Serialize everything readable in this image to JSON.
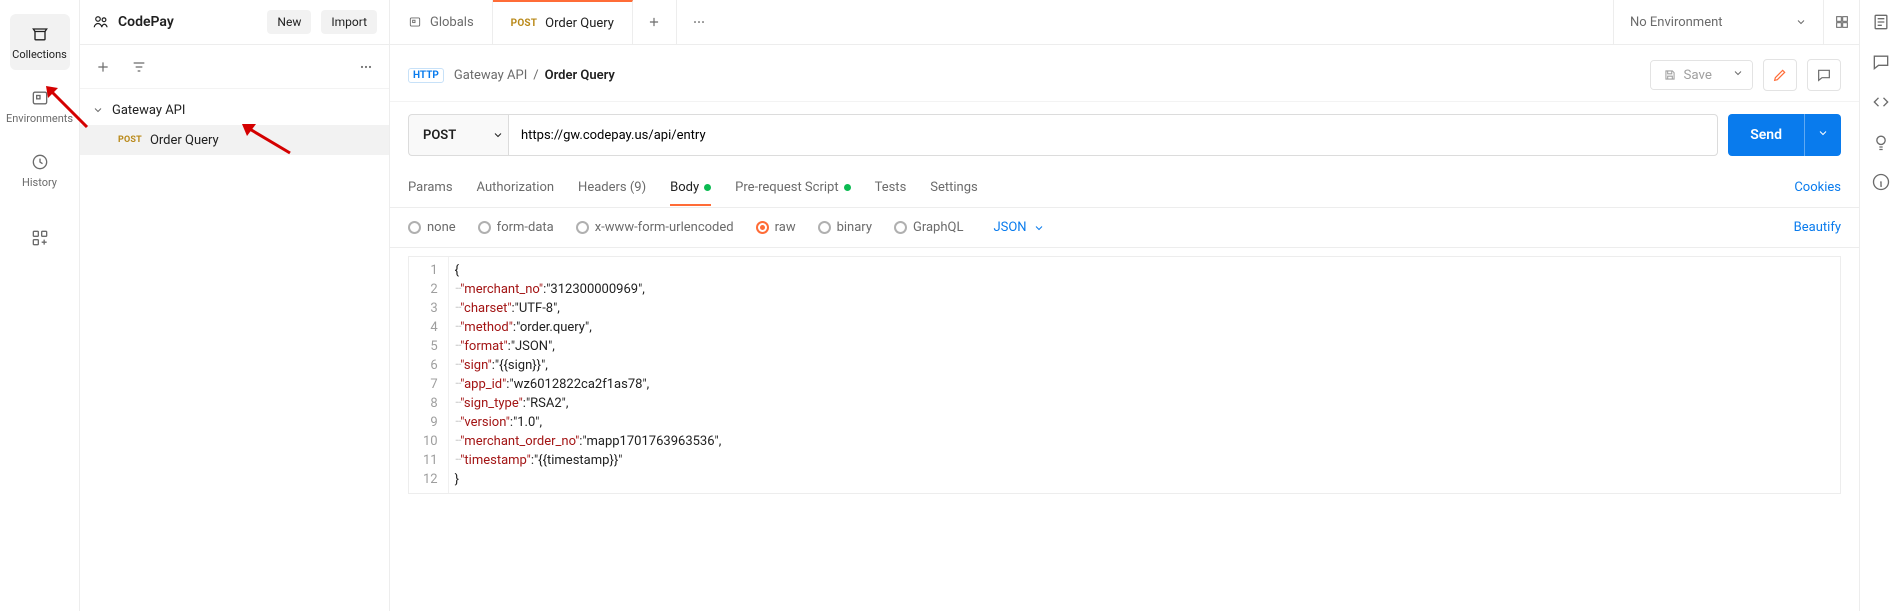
{
  "workspace": {
    "name": "CodePay",
    "new_label": "New",
    "import_label": "Import"
  },
  "left_rail": {
    "collections": "Collections",
    "environments": "Environments",
    "history": "History"
  },
  "sidebar": {
    "collection_name": "Gateway API",
    "item_method": "POST",
    "item_name": "Order Query"
  },
  "tabs": {
    "globals": "Globals",
    "active_method": "POST",
    "active_name": "Order Query",
    "env_label": "No Environment"
  },
  "breadcrumb": {
    "parent": "Gateway API",
    "current": "Order Query"
  },
  "toolbar": {
    "save_label": "Save"
  },
  "request": {
    "method": "POST",
    "url": "https://gw.codepay.us/api/entry",
    "send_label": "Send"
  },
  "subtabs": {
    "params": "Params",
    "authorization": "Authorization",
    "headers": "Headers (9)",
    "body": "Body",
    "prerequest": "Pre-request Script",
    "tests": "Tests",
    "settings": "Settings",
    "cookies": "Cookies"
  },
  "body_types": {
    "none": "none",
    "form_data": "form-data",
    "xform": "x-www-form-urlencoded",
    "raw": "raw",
    "binary": "binary",
    "graphql": "GraphQL",
    "format": "JSON",
    "beautify": "Beautify"
  },
  "editor": {
    "lines": [
      "{",
      "····\"merchant_no\":\"312300000969\",",
      "····\"charset\":\"UTF-8\",",
      "····\"method\":\"order.query\",",
      "····\"format\":\"JSON\",",
      "····\"sign\":\"{{sign}}\",",
      "····\"app_id\":\"wz6012822ca2f1as78\",",
      "····\"sign_type\":\"RSA2\",",
      "····\"version\":\"1.0\",",
      "····\"merchant_order_no\":\"mapp1701763963536\",",
      "····\"timestamp\":\"{{timestamp}}\"",
      "}"
    ],
    "body_json": {
      "merchant_no": "312300000969",
      "charset": "UTF-8",
      "method": "order.query",
      "format": "JSON",
      "sign": "{{sign}}",
      "app_id": "wz6012822ca2f1as78",
      "sign_type": "RSA2",
      "version": "1.0",
      "merchant_order_no": "mapp1701763963536",
      "timestamp": "{{timestamp}}"
    }
  }
}
